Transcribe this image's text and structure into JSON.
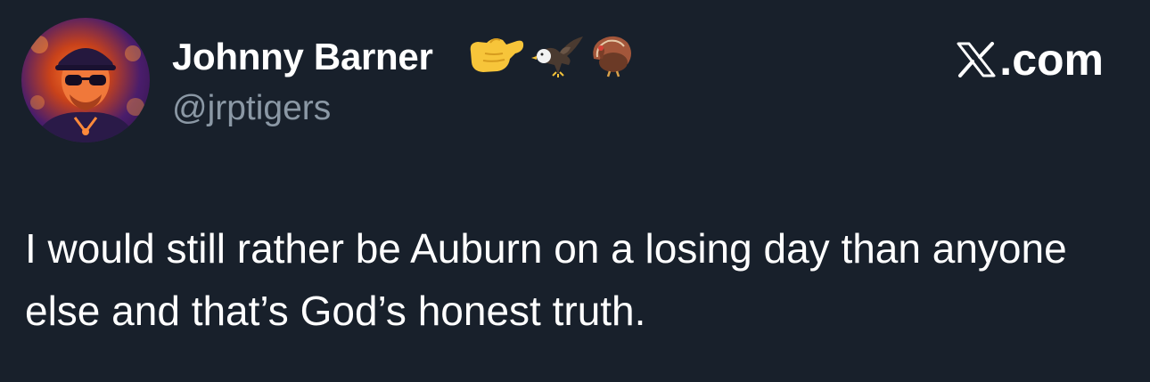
{
  "tweet": {
    "author": {
      "display_name": "Johnny Barner",
      "handle": "@jrptigers",
      "name_emojis": [
        "call-me-hand-emoji",
        "eagle-emoji",
        "turkey-emoji"
      ]
    },
    "brand": {
      "label": ".com",
      "logo": "x-logo-icon"
    },
    "text": "I would still rather be Auburn on a losing day than anyone else and that’s God’s honest truth."
  },
  "colors": {
    "background": "#18202b",
    "primary_text": "#ffffff",
    "secondary_text": "#8b98a5",
    "avatar_accent": "#ff7a2a"
  }
}
